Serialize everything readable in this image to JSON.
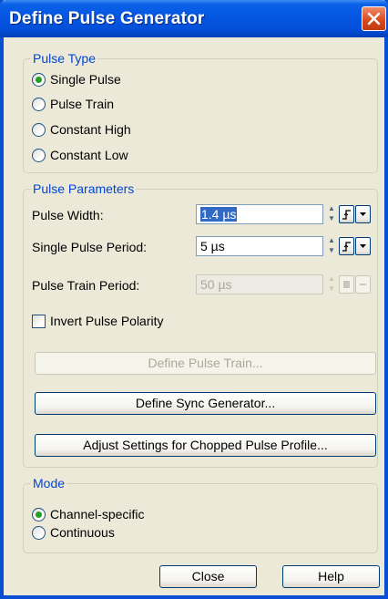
{
  "window": {
    "title": "Define Pulse Generator"
  },
  "pulse_type": {
    "legend": "Pulse Type",
    "options": [
      {
        "label": "Single Pulse",
        "selected": true
      },
      {
        "label": "Pulse Train",
        "selected": false
      },
      {
        "label": "Constant High",
        "selected": false
      },
      {
        "label": "Constant Low",
        "selected": false
      }
    ]
  },
  "pulse_parameters": {
    "legend": "Pulse Parameters",
    "pulse_width": {
      "label": "Pulse Width:",
      "value": "1.4 µs",
      "enabled": true
    },
    "single_pulse_period": {
      "label": "Single Pulse Period:",
      "value": "5 µs",
      "enabled": true
    },
    "pulse_train_period": {
      "label": "Pulse Train Period:",
      "value": "50 µs",
      "enabled": false
    },
    "invert_polarity": {
      "label": "Invert Pulse Polarity",
      "checked": false
    },
    "define_pulse_train_label": "Define Pulse Train...",
    "define_sync_generator_label": "Define Sync Generator...",
    "adjust_settings_label": "Adjust Settings for Chopped Pulse Profile..."
  },
  "mode": {
    "legend": "Mode",
    "options": [
      {
        "label": "Channel-specific",
        "selected": true
      },
      {
        "label": "Continuous",
        "selected": false
      }
    ]
  },
  "footer": {
    "close_label": "Close",
    "help_label": "Help"
  },
  "colors": {
    "title_bar": "#0454e0",
    "group_legend": "#0046d5",
    "dialog_bg": "#ece9d8"
  }
}
